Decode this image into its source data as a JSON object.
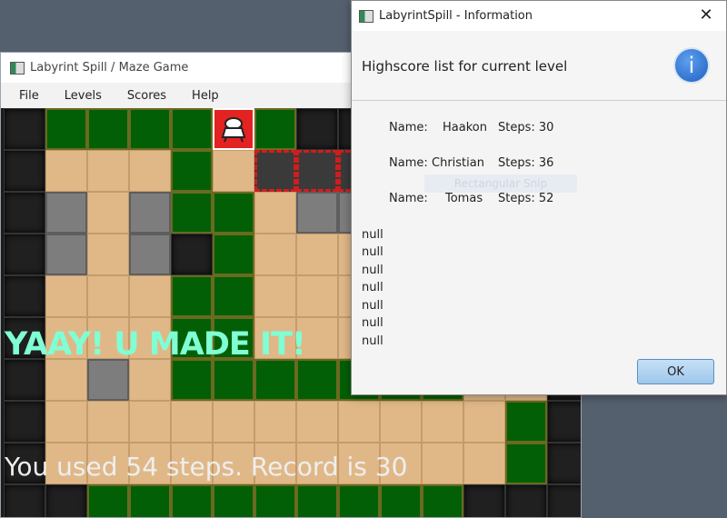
{
  "game_window": {
    "title": "Labyrint Spill / Maze Game",
    "menu": [
      "File",
      "Levels",
      "Scores",
      "Help"
    ],
    "win_message": "YAAY! U MADE IT!",
    "steps_message": "You used 54 steps. Record is 30",
    "colors": {
      "wall": "#035f06",
      "floor": "#e0b888",
      "void": "#202020",
      "stone": "#7d7d7d",
      "message_accent": "#7fffd4"
    },
    "legend": {
      "G": "wall-tile",
      "T": "floor-tile",
      "D": "dark-tile",
      "S": "stone-tile",
      "X": "locked-tile",
      "P": "player-tile"
    },
    "maze": [
      "DGGGGPGDDDDDDD",
      "DTTTGTXXXDDDDD",
      "DSTSGGTSSDDDDD",
      "DSTSDGTTTDDDDD",
      "DTTTGGTTTDDDDD",
      "DTTTGGTTTDDDDD",
      "DTSTGGGGGGGTTD",
      "DTTTTTTTTTTTGD",
      "DTTTTTTTTTTTGD",
      "DDGGGGGGGGGDDD"
    ]
  },
  "dialog": {
    "title": "LabyrintSpill - Information",
    "header": "Highscore list for current level",
    "info_icon": "info-icon",
    "scores": [
      {
        "label": "Name:",
        "name": "Haakon",
        "steps": "Steps: 30"
      },
      {
        "label": "Name:",
        "name": "Christian",
        "steps": "Steps: 36"
      },
      {
        "label": "Name:",
        "name": "Tomas",
        "steps": "Steps: 52"
      }
    ],
    "nulls": [
      "null",
      "null",
      "null",
      "null",
      "null",
      "null",
      "null"
    ],
    "ok_label": "OK",
    "ghost_text": "Rectangular Snip"
  }
}
